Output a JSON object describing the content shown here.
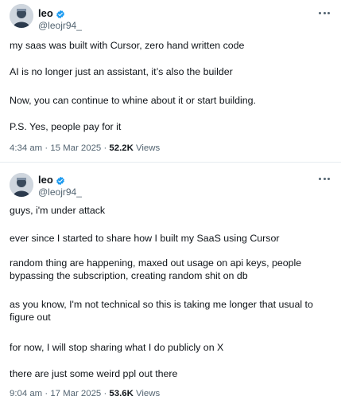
{
  "tweets": [
    {
      "author_name": "leo",
      "author_handle": "@leojr94_",
      "paragraphs": [
        "my saas was built with Cursor, zero hand written code",
        "AI is no longer just an assistant, it’s also the builder",
        "Now, you can continue to whine about it or start building.",
        "P.S. Yes, people pay for it"
      ],
      "time": "4:34 am",
      "separator": "·",
      "date": "15 Mar 2025",
      "views_count": "52.2K",
      "views_label": "Views"
    },
    {
      "author_name": "leo",
      "author_handle": "@leojr94_",
      "paragraphs": [
        "guys, i'm under attack",
        "ever since I started to share how I built my SaaS using Cursor",
        "random thing are happening, maxed out usage on api keys, people bypassing the subscription, creating random shit on db",
        "as you know, I'm not technical so this is taking me longer that usual to figure out",
        "for now, I will stop sharing what I do publicly on X",
        "there are just some weird ppl out there"
      ],
      "time": "9:04 am",
      "separator": "·",
      "date": "17 Mar 2025",
      "views_count": "53.6K",
      "views_label": "Views"
    }
  ],
  "icons": {
    "verified": "verified-badge-icon",
    "more": "more-options-icon",
    "avatar": "avatar"
  },
  "colors": {
    "verified_blue": "#1d9bf0",
    "text": "#0f1419",
    "secondary": "#536471",
    "divider": "#e6ecf0"
  }
}
